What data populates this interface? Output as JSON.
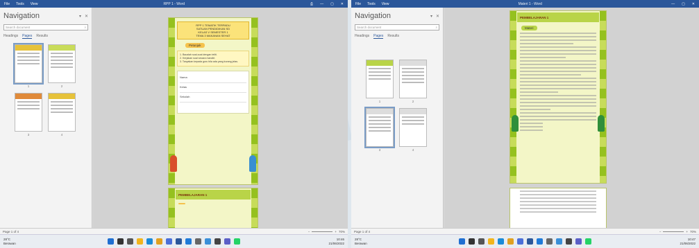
{
  "left": {
    "titlebar": {
      "menu": [
        "File",
        "Tools",
        "View"
      ],
      "doc_title": "RPP 1 - Word",
      "controls": [
        "⎙",
        "—",
        "▢",
        "✕"
      ]
    },
    "nav": {
      "title": "Navigation",
      "search_placeholder": "Search document",
      "tabs": [
        "Headings",
        "Pages",
        "Results"
      ],
      "active_tab": "Pages",
      "thumb_numbers": [
        "1",
        "2",
        "3",
        "4"
      ]
    },
    "page1": {
      "banner": [
        "RPP 1 TEMATIK TERPADU",
        "SATUAN PENDIDIKAN SD",
        "KELAS V SEMESTER 1",
        "TEMA 3 MAKANAN SEHAT"
      ],
      "pill": "Petunjuk",
      "instructions": [
        "1. Bacalah soal-soal dengan teliti.",
        "2. Kerjakan soal secara mandiri.",
        "3. Tanyakan kepada guru bila ada yang kurang jelas."
      ],
      "fields": [
        "Nama",
        "Kelas",
        "Sekolah"
      ]
    },
    "page2": {
      "header": "PEMBELAJARAN 1"
    },
    "status": {
      "page": "Page 1 of 4",
      "zoom": "70%"
    },
    "taskbar": {
      "weather_temp": "28°C",
      "weather_desc": "Berawan",
      "time": "10:46",
      "date": "21/06/2022"
    }
  },
  "right": {
    "titlebar": {
      "menu": [
        "File",
        "Tools",
        "View"
      ],
      "doc_title": "Materi 1 - Word",
      "controls": [
        "—",
        "▢",
        "✕"
      ]
    },
    "nav": {
      "title": "Navigation",
      "search_placeholder": "Search document",
      "tabs": [
        "Headings",
        "Pages",
        "Results"
      ],
      "active_tab": "Pages",
      "thumb_numbers": [
        "1",
        "2",
        "3",
        "4"
      ]
    },
    "page1": {
      "header": "PEMBELAJARAN 1",
      "pill": "Materi"
    },
    "page2": {},
    "status": {
      "page": "Page 1 of 4",
      "zoom": "70%"
    },
    "taskbar": {
      "weather_temp": "28°C",
      "weather_desc": "Berawan",
      "time": "10:47",
      "date": "21/06/2022"
    }
  },
  "colors": {
    "titlebar": "#2b579a",
    "page": "#f3f6c7",
    "green_edge": "#95c11f",
    "banner": "#fbe37a"
  },
  "taskbar_apps": [
    "windows-icon",
    "search-icon",
    "task-view-icon",
    "folder-icon",
    "edge-icon",
    "chrome-icon",
    "store-icon",
    "word-icon",
    "mail-icon",
    "settings-icon",
    "photos-icon",
    "camera-icon",
    "teams-icon",
    "whatsapp-icon"
  ]
}
